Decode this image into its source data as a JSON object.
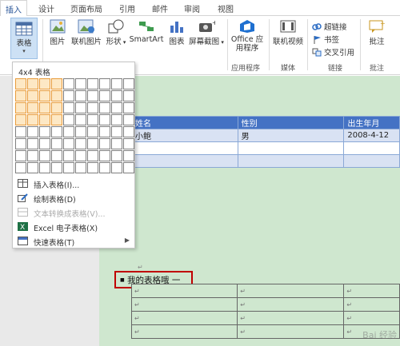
{
  "tabs": [
    "插入",
    "设计",
    "页面布局",
    "引用",
    "邮件",
    "审阅",
    "视图"
  ],
  "ribbon": {
    "table_label": "表格",
    "picture_label": "图片",
    "online_picture_label": "联机图片",
    "shapes_label": "形状",
    "smartart_label": "SmartArt",
    "chart_label": "图表",
    "screenshot_label": "屏幕截图",
    "office_apps_label": "Office 应用程序",
    "apps_group": "应用程序",
    "online_video_label": "联机视频",
    "media_group": "媒体",
    "hyperlink_label": "超链接",
    "bookmark_label": "书签",
    "crossref_label": "交叉引用",
    "links_group": "链接",
    "comment_label": "批注",
    "comment_group": "批注"
  },
  "dropdown": {
    "title": "4x4 表格",
    "grid_cols": 10,
    "grid_rows": 8,
    "selected_cols": 4,
    "selected_rows": 4,
    "items": [
      {
        "label": "插入表格(I)...",
        "icon": "insert-table-icon",
        "disabled": false,
        "submenu": false
      },
      {
        "label": "绘制表格(D)",
        "icon": "draw-table-icon",
        "disabled": false,
        "submenu": false
      },
      {
        "label": "文本转换成表格(V)...",
        "icon": "text-to-table-icon",
        "disabled": true,
        "submenu": false
      },
      {
        "label": "Excel 电子表格(X)",
        "icon": "excel-icon",
        "disabled": false,
        "submenu": false
      },
      {
        "label": "快速表格(T)",
        "icon": "quick-table-icon",
        "disabled": false,
        "submenu": true
      }
    ]
  },
  "document": {
    "table1": {
      "headers": [
        "姓名",
        "性别",
        "出生年月"
      ],
      "rows": [
        [
          "小鲍",
          "男",
          "2008-4-12"
        ],
        [
          "",
          "",
          ""
        ],
        [
          "",
          "",
          ""
        ]
      ]
    },
    "caption": "我的表格哦 一",
    "colors": {
      "page": "#cfe7cf",
      "table_header": "#4472c4",
      "highlight": "#c00000"
    }
  },
  "watermark": "Bai 经验"
}
